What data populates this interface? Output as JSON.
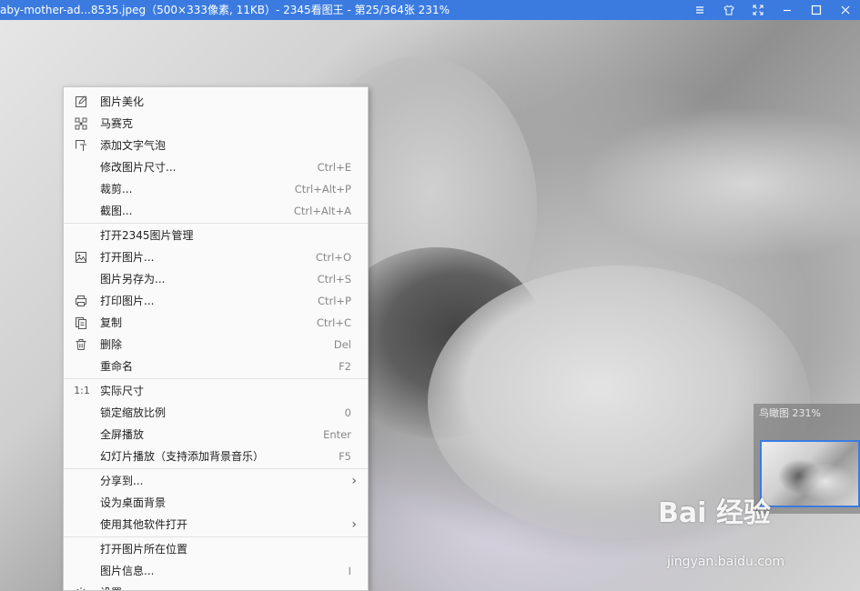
{
  "window": {
    "title": "aby-mother-ad...8535.jpeg（500×333像素, 11KB）- 2345看图王 - 第25/364张 231%"
  },
  "menu": {
    "items": [
      {
        "label": "图片美化",
        "shortcut": "",
        "icon": "edit-icon"
      },
      {
        "label": "马赛克",
        "shortcut": "",
        "icon": "mosaic-icon"
      },
      {
        "label": "添加文字气泡",
        "shortcut": "",
        "icon": "text-bubble-icon"
      },
      {
        "label": "修改图片尺寸...",
        "shortcut": "Ctrl+E",
        "icon": ""
      },
      {
        "label": "裁剪...",
        "shortcut": "Ctrl+Alt+P",
        "icon": ""
      },
      {
        "label": "截图...",
        "shortcut": "Ctrl+Alt+A",
        "icon": ""
      },
      {
        "label": "打开2345图片管理",
        "shortcut": "",
        "icon": ""
      },
      {
        "label": "打开图片...",
        "shortcut": "Ctrl+O",
        "icon": "image-icon"
      },
      {
        "label": "图片另存为...",
        "shortcut": "Ctrl+S",
        "icon": ""
      },
      {
        "label": "打印图片...",
        "shortcut": "Ctrl+P",
        "icon": "printer-icon"
      },
      {
        "label": "复制",
        "shortcut": "Ctrl+C",
        "icon": "copy-icon"
      },
      {
        "label": "删除",
        "shortcut": "Del",
        "icon": "trash-icon"
      },
      {
        "label": "重命名",
        "shortcut": "F2",
        "icon": ""
      },
      {
        "label": "实际尺寸",
        "shortcut": "",
        "icon": "actual-size-icon",
        "icon_text": "1:1"
      },
      {
        "label": "锁定缩放比例",
        "shortcut": "0",
        "icon": ""
      },
      {
        "label": "全屏播放",
        "shortcut": "Enter",
        "icon": ""
      },
      {
        "label": "幻灯片播放（支持添加背景音乐）",
        "shortcut": "F5",
        "icon": ""
      },
      {
        "label": "分享到...",
        "shortcut": "",
        "icon": "",
        "submenu": true
      },
      {
        "label": "设为桌面背景",
        "shortcut": "",
        "icon": ""
      },
      {
        "label": "使用其他软件打开",
        "shortcut": "",
        "icon": "",
        "submenu": true
      },
      {
        "label": "打开图片所在位置",
        "shortcut": "",
        "icon": ""
      },
      {
        "label": "图片信息...",
        "shortcut": "I",
        "icon": ""
      },
      {
        "label": "设置",
        "shortcut": "",
        "icon": "gear-icon"
      }
    ]
  },
  "navigator": {
    "label": "鸟瞰图 231%"
  },
  "watermark": {
    "main": "Bai 经验",
    "sub": "jingyan.baidu.com"
  },
  "colors": {
    "titlebar": "#3b7be0",
    "menu_bg": "#fafafa"
  }
}
